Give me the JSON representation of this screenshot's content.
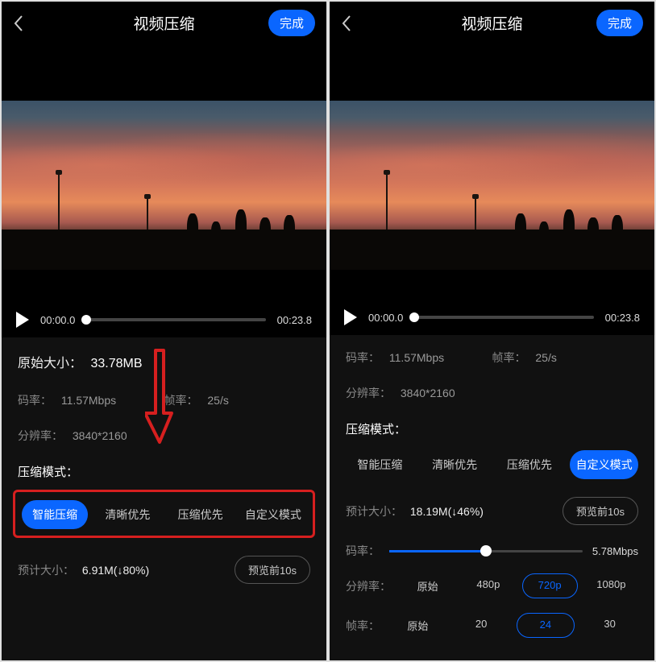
{
  "left": {
    "header": {
      "title": "视频压缩",
      "done": "完成"
    },
    "player": {
      "current": "00:00.0",
      "duration": "00:23.8"
    },
    "info": {
      "orig_label": "原始大小：",
      "orig_value": "33.78MB",
      "bitrate_label": "码率：",
      "bitrate_value": "11.57Mbps",
      "fps_label": "帧率：",
      "fps_value": "25/s",
      "res_label": "分辨率：",
      "res_value": "3840*2160",
      "mode_label": "压缩模式：",
      "modes": [
        "智能压缩",
        "清晰优先",
        "压缩优先",
        "自定义模式"
      ],
      "est_label": "预计大小：",
      "est_value": "6.91M(↓80%)",
      "preview": "预览前10s"
    }
  },
  "right": {
    "header": {
      "title": "视频压缩",
      "done": "完成"
    },
    "player": {
      "current": "00:00.0",
      "duration": "00:23.8"
    },
    "info": {
      "bitrate_label": "码率：",
      "bitrate_value": "11.57Mbps",
      "fps_label": "帧率：",
      "fps_value": "25/s",
      "res_label": "分辨率：",
      "res_value": "3840*2160",
      "mode_label": "压缩模式：",
      "modes": [
        "智能压缩",
        "清晰优先",
        "压缩优先",
        "自定义模式"
      ],
      "est_label": "预计大小：",
      "est_value": "18.19M(↓46%)",
      "preview": "预览前10s",
      "slider_bitrate_label": "码率：",
      "slider_bitrate_value": "5.78Mbps",
      "res_ctrl_label": "分辨率：",
      "res_opts": [
        "原始",
        "480p",
        "720p",
        "1080p"
      ],
      "fps_ctrl_label": "帧率：",
      "fps_opts": [
        "原始",
        "20",
        "24",
        "30"
      ]
    }
  }
}
